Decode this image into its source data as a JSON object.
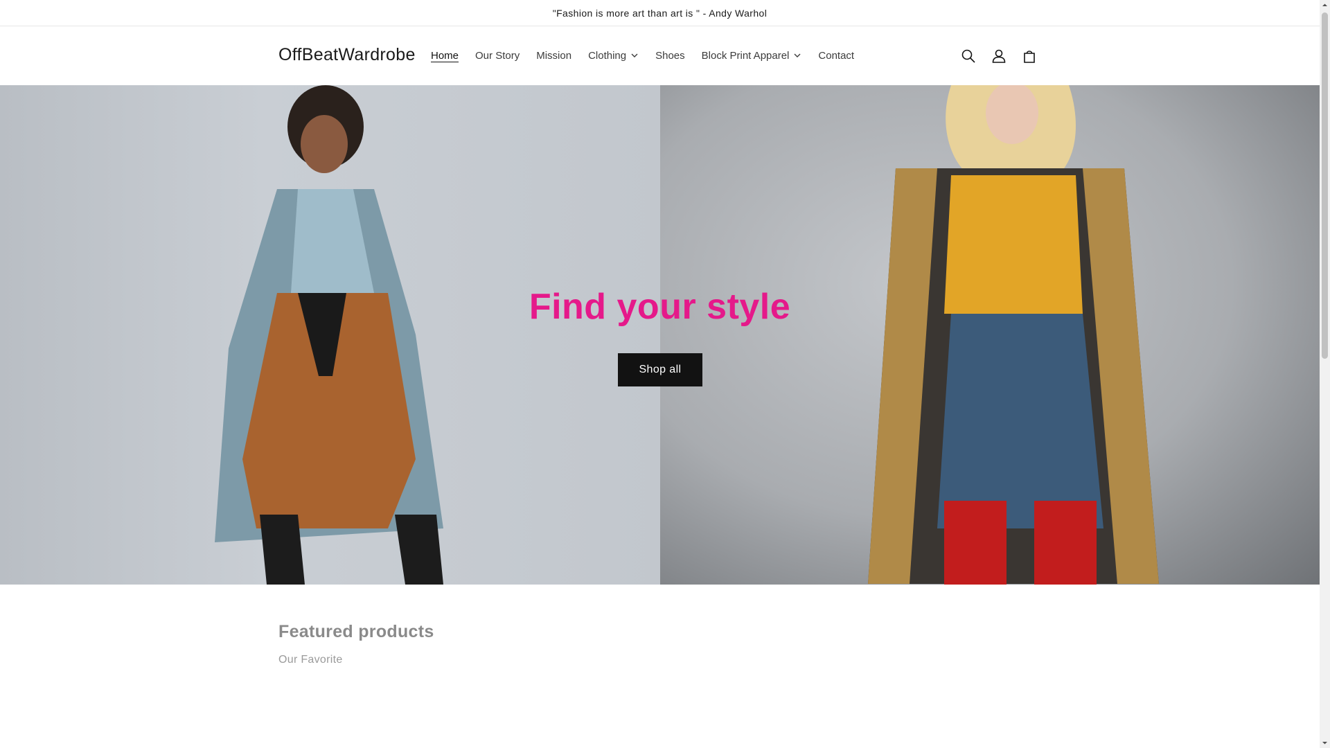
{
  "announcement": {
    "text": "\"Fashion is more art than art is \" - Andy Warhol"
  },
  "header": {
    "logo": "OffBeatWardrobe",
    "nav": [
      {
        "label": "Home",
        "active": true,
        "dropdown": false
      },
      {
        "label": "Our Story",
        "active": false,
        "dropdown": false
      },
      {
        "label": "Mission",
        "active": false,
        "dropdown": false
      },
      {
        "label": "Clothing",
        "active": false,
        "dropdown": true
      },
      {
        "label": "Shoes",
        "active": false,
        "dropdown": false
      },
      {
        "label": "Block Print Apparel",
        "active": false,
        "dropdown": true
      },
      {
        "label": "Contact",
        "active": false,
        "dropdown": false
      }
    ],
    "icons": [
      "search-icon",
      "account-icon",
      "cart-icon"
    ]
  },
  "hero": {
    "title": "Find your style",
    "button_label": "Shop all",
    "title_color": "#e5198a"
  },
  "featured": {
    "title": "Featured products",
    "subtitle": "Our Favorite"
  }
}
